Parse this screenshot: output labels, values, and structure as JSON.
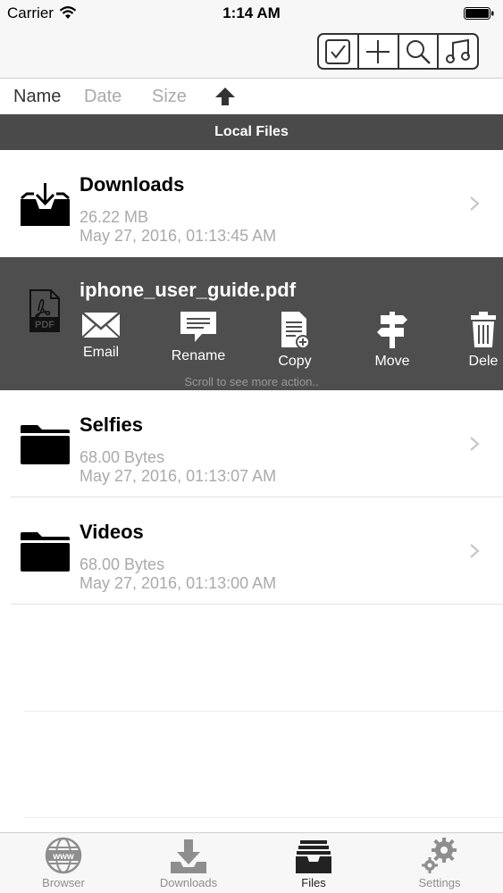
{
  "status": {
    "carrier": "Carrier",
    "time": "1:14 AM"
  },
  "toolbar": {
    "icons": [
      "checkbox-icon",
      "plus-icon",
      "search-icon",
      "music-icon"
    ]
  },
  "sort": {
    "name": "Name",
    "date": "Date",
    "size": "Size",
    "direction": "ascending"
  },
  "section": {
    "title": "Local Files"
  },
  "files": [
    {
      "name": "Downloads",
      "size": "26.22 MB",
      "date": "May 27, 2016, 01:13:45 AM",
      "icon": "download-tray-icon"
    },
    {
      "name": "Selfies",
      "size": "68.00 Bytes",
      "date": "May 27, 2016, 01:13:07 AM",
      "icon": "folder-icon"
    },
    {
      "name": "Videos",
      "size": "68.00 Bytes",
      "date": "May 27, 2016, 01:13:00 AM",
      "icon": "folder-icon"
    }
  ],
  "active_file": {
    "name": "iphone_user_guide.pdf",
    "icon": "pdf-icon",
    "actions": [
      {
        "label": "Email",
        "icon": "envelope-icon"
      },
      {
        "label": "Rename",
        "icon": "speech-bubble-icon"
      },
      {
        "label": "Copy",
        "icon": "document-copy-icon"
      },
      {
        "label": "Move",
        "icon": "signpost-icon"
      },
      {
        "label": "Dele",
        "icon": "trash-icon"
      }
    ],
    "hint": "Scroll to see more action.."
  },
  "tabs": [
    {
      "label": "Browser",
      "icon": "globe-www-icon",
      "active": false
    },
    {
      "label": "Downloads",
      "icon": "download-tray-icon",
      "active": false
    },
    {
      "label": "Files",
      "icon": "files-drawer-icon",
      "active": true
    },
    {
      "label": "Settings",
      "icon": "gears-icon",
      "active": false
    }
  ]
}
